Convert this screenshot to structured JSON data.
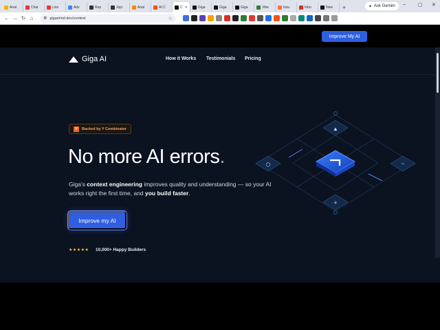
{
  "browser": {
    "tabs": [
      {
        "label": "Anal",
        "color": "#f4b400"
      },
      {
        "label": "Char",
        "color": "#e53935"
      },
      {
        "label": "Live",
        "color": "#e53935"
      },
      {
        "label": "Adv",
        "color": "#4285f4"
      },
      {
        "label": "Rep",
        "color": "#333333"
      },
      {
        "label": "Jojo",
        "color": "#333333"
      },
      {
        "label": "Anal",
        "color": "#f48c06"
      },
      {
        "label": "AI C",
        "color": "#f4511e"
      },
      {
        "label": "C",
        "color": "#111111",
        "active": true
      },
      {
        "label": "Giga",
        "color": "#111111"
      },
      {
        "label": "Giga",
        "color": "#111111"
      },
      {
        "label": "Giga",
        "color": "#111111"
      },
      {
        "label": "Vibe",
        "color": "#2e7d32"
      },
      {
        "label": "Issu",
        "color": "#ff7043"
      },
      {
        "label": "Inbo",
        "color": "#d93025"
      },
      {
        "label": "New",
        "color": "#111111"
      }
    ],
    "new_tab": "+",
    "ask_gemini": "Ask Gemini",
    "url": "gigamind.dev/context"
  },
  "site": {
    "logo_text": "Giga AI",
    "nav": [
      "How it Works",
      "Testimonials",
      "Pricing"
    ],
    "cta_top": "Improve My AI",
    "badge": "Backed by Y Combinator",
    "badge_logo": "Y",
    "headline_main": "No more AI errors",
    "headline_dot": ".",
    "sub_prefix": "Giga's ",
    "sub_bold1": "context engineering",
    "sub_mid": " improves quality and understanding — so your AI works right the first time, and ",
    "sub_bold2": "you build faster",
    "sub_suffix": ".",
    "cta_main": "Improve my AI",
    "stars": "★★★★★",
    "builders": "10,000+ Happy Builders"
  },
  "colors": {
    "accent": "#2f5fe0",
    "bg": "#0b1220"
  }
}
